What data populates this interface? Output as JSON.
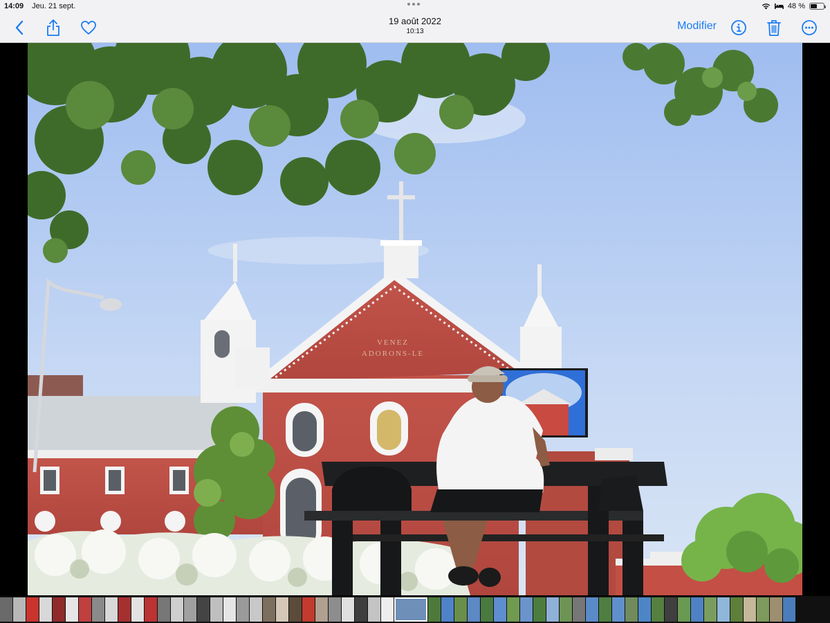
{
  "status_bar": {
    "time": "14:09",
    "date": "Jeu. 21 sept.",
    "battery": "48 %",
    "battery_level": 0.48
  },
  "nav": {
    "back_icon": "chevron-left-icon",
    "share_icon": "share-icon",
    "favorite_icon": "heart-icon",
    "photo_date": "19 août 2022",
    "photo_time": "10:13",
    "edit_label": "Modifier",
    "info_icon": "info-icon",
    "delete_icon": "trash-icon",
    "more_icon": "more-icon",
    "accent_color": "#1a7cf5"
  },
  "photo": {
    "sign_line1": "VENEZ",
    "sign_line2": "ADORONS-LE"
  },
  "filmstrip": {
    "thumb_colors": [
      "#6a6a6a",
      "#b8b8b8",
      "#c9342e",
      "#d8d8d8",
      "#8f2b2b",
      "#e6e6e6",
      "#c04040",
      "#8a8a8a",
      "#d9d9d9",
      "#a53030",
      "#e2e2e2",
      "#b33",
      "#777",
      "#cfcfcf",
      "#a0a0a0",
      "#444",
      "#bfbfbf",
      "#e5e5e5",
      "#9a9a9a",
      "#c8c8c8",
      "#7d6f60",
      "#d5c7b8",
      "#5b4b3b",
      "#c23b2e",
      "#b0a090",
      "#8d8d8d",
      "#e0e0e0",
      "#3f3f3f",
      "#c4c4c4",
      "#eeeeee",
      "#6d8fb8",
      "#4d7a3a",
      "#4f82c8",
      "#6a8f4a",
      "#5c88c4",
      "#4a7a40",
      "#5e8ed0",
      "#709a50",
      "#6b94cc",
      "#4c7d3f",
      "#8fb0d8",
      "#6e9455",
      "#777",
      "#5a8ac8",
      "#4e7e42",
      "#6090cc",
      "#718b5c",
      "#4d86c6",
      "#55803f",
      "#3f3f3f",
      "#6a9a52",
      "#4e82c4",
      "#7a9d5e",
      "#8fb7d9",
      "#5d7f3b",
      "#c5b79a",
      "#7d9a5c",
      "#9e8e70",
      "#4b7dbb"
    ]
  }
}
